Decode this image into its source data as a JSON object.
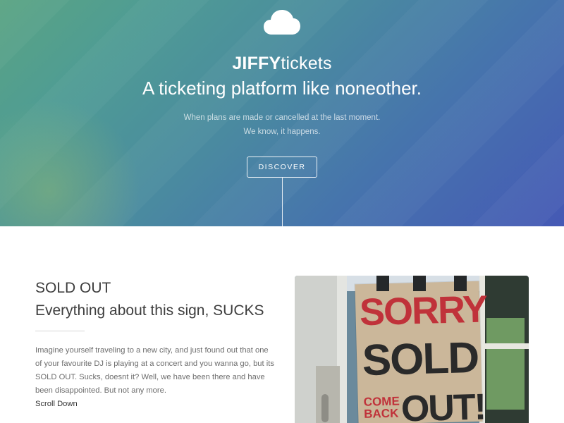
{
  "hero": {
    "icon": "cloud-icon",
    "brand_bold": "JIFFY",
    "brand_light": "tickets",
    "tagline": "A ticketing platform like noneother.",
    "subline_1": "When plans are made or cancelled at the last moment.",
    "subline_2": "We know, it happens.",
    "cta_label": "DISCOVER"
  },
  "section": {
    "title_line1": "SOLD OUT",
    "title_line2": "Everything about this sign, SUCKS",
    "body": "Imagine yourself traveling to a new city, and just found out that one of your favourite DJ is playing at a concert and you wanna go, but its SOLD OUT. Sucks, doesnt it? Well, we have been there and have been disappointed. But not any more.",
    "scroll_label": "Scroll Down",
    "photo": {
      "sign_line1": "SORRY",
      "sign_line2": "SOLD",
      "sign_line3": "COME BACK",
      "sign_line4": "OUT!"
    }
  }
}
